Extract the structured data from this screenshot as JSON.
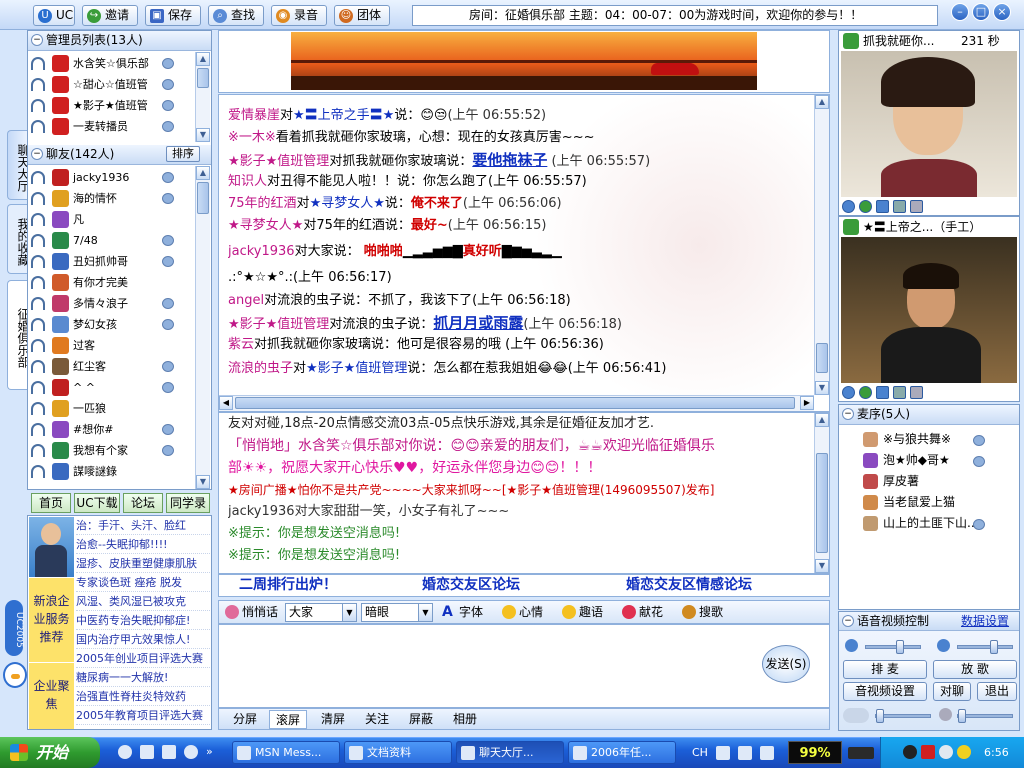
{
  "toolbar": {
    "uc": "UC",
    "invite": "邀请",
    "save": "保存",
    "find": "查找",
    "record": "录音",
    "group": "团体"
  },
  "roominfo": "房间：征婚俱乐部    主题：04：00-07：00为游戏时间，欢迎你的参与！！",
  "sidetabs": [
    "聊天大厅",
    "我的收藏",
    "征婚俱乐部"
  ],
  "admins": {
    "header": "管理员列表(13人)",
    "items": [
      "水含笑☆俱乐部",
      "☆甜心☆值班管",
      "★影子★值班管",
      "一麦转播员"
    ]
  },
  "friends": {
    "header": "聊友(142人)",
    "sort": "排序",
    "items": [
      "jacky1936",
      "海的情怀",
      "凡",
      "7/48",
      "丑妇抓帅哥",
      "有你才完美",
      "多情々浪子",
      "梦幻女孩",
      "过客",
      "红尘客",
      "^ ^",
      "一匹狼",
      "#想你#",
      "我想有个家",
      "謀嘜謎錄"
    ]
  },
  "nav": [
    "首页",
    "UC下载",
    "论坛",
    "同学录"
  ],
  "ads": {
    "side1": "新浪企业服务推荐",
    "side2": "企业聚焦",
    "lines": [
      "治：手汗、头汗、脸红",
      "治愈--失眠抑郁!!!!",
      "湿疹、皮肤重塑健康肌肤",
      "专家谈色斑 痤疮 脱发",
      "风湿、类风湿已被攻克",
      "中医药专治失眠抑郁症!",
      "国内治疗甲亢效果惊人!",
      "2005年创业项目评选大赛",
      "糖尿病一一大解放!",
      "治强直性脊柱炎特效药",
      "2005年教育项目评选大赛"
    ]
  },
  "uc_logo": "UC2005",
  "chat1": [
    {
      "segs": [
        {
          "t": "爱情暴崖",
          "c": "u"
        },
        {
          "t": "对"
        },
        {
          "t": "★〓上帝之手〓★",
          "c": "bl"
        },
        {
          "t": "说："
        },
        {
          "t": "😊😒",
          "c": "em"
        },
        {
          "t": "(上午 06:55:52)",
          "c": "ts"
        }
      ]
    },
    {
      "segs": [
        {
          "t": "※一木※",
          "c": "u"
        },
        {
          "t": "看着抓我就砸你家玻璃，心想：现在的女孩真厉害~~~"
        }
      ]
    },
    {
      "segs": [
        {
          "t": "★影子★值班管理",
          "c": "u"
        },
        {
          "t": "对抓我就砸你家玻璃说："
        },
        {
          "t": "要他拖袜子",
          "c": "lk"
        },
        {
          "t": " (上午 06:55:57)",
          "c": "ts"
        }
      ]
    },
    {
      "segs": [
        {
          "t": "知识人",
          "c": "u"
        },
        {
          "t": "对丑得不能见人啦！！说：你怎么跑了(上午 06:55:57)"
        }
      ]
    },
    {
      "segs": [
        {
          "t": "75年的红酒",
          "c": "u"
        },
        {
          "t": "对"
        },
        {
          "t": "★寻梦女人★",
          "c": "bl"
        },
        {
          "t": "说："
        },
        {
          "t": "俺不来了",
          "c": "rd"
        },
        {
          "t": "(上午 06:56:06)",
          "c": "ts"
        }
      ]
    },
    {
      "segs": [
        {
          "t": "★寻梦女人★",
          "c": "u"
        },
        {
          "t": "对75年的红酒说："
        },
        {
          "t": "最好~",
          "c": "rd"
        },
        {
          "t": "(上午 06:56:15)",
          "c": "ts"
        }
      ]
    },
    {
      "segs": [
        {
          "t": "jacky1936",
          "c": "u"
        },
        {
          "t": "对大家说：  "
        },
        {
          "t": "啪啪啪",
          "c": "rd"
        },
        {
          "t": "▁▂▃▅▆▇"
        },
        {
          "t": "真好听",
          "c": "rd"
        },
        {
          "t": "▇▆▅▃▂▁"
        }
      ]
    },
    {
      "segs": [
        {
          "t": ".:°★☆★°.:(上午 06:56:17)"
        }
      ]
    },
    {
      "segs": [
        {
          "t": "angel",
          "c": "u"
        },
        {
          "t": "对流浪的虫子说：不抓了，我该下了(上午 06:56:18)"
        }
      ]
    },
    {
      "segs": [
        {
          "t": "★影子★值班管理",
          "c": "u"
        },
        {
          "t": "对流浪的虫子说："
        },
        {
          "t": "抓月月或雨露",
          "c": "lk"
        },
        {
          "t": "(上午 06:56:18)",
          "c": "ts"
        }
      ]
    },
    {
      "segs": [
        {
          "t": "紫云",
          "c": "u"
        },
        {
          "t": "对抓我就砸你家玻璃说：他可是很容易的哦 (上午 06:56:36)"
        }
      ]
    },
    {
      "segs": [
        {
          "t": "流浪的虫子",
          "c": "u"
        },
        {
          "t": "对"
        },
        {
          "t": "★影子★值班管理",
          "c": "bl"
        },
        {
          "t": "说：怎么都在惹我姐姐😂😂(上午 06:56:41)"
        }
      ]
    }
  ],
  "chat2": [
    "友对对碰,18点-20点情感交流03点-05点快乐游戏,其余是征婚征友加才艺.",
    "「悄悄地」水含笑☆俱乐部对你说：😊😊亲爱的朋友们，☕☕欢迎光临征婚俱乐",
    "部☀☀，祝愿大家开心快乐♥♥，好运永伴您身边😊😊！！！",
    "★房间广播★怕你不是共产党~~~~大家来抓呀~~[★影子★值班管理(1496095507)发布]",
    "jacky1936对大家甜甜一笑，小女子有礼了~~~",
    "※提示：你是想发送空消息吗!",
    "※提示：你是想发送空消息吗!"
  ],
  "links": [
    "二周排行出炉！",
    "婚恋交友区论坛",
    "婚恋交友区情感论坛"
  ],
  "input": {
    "whisper": "悄悄话",
    "target": "大家",
    "action": "暗眼",
    "font": "字体",
    "mood": "心情",
    "fun": "趣语",
    "flower": "献花",
    "dance": "搜歌",
    "send": "发送(S)"
  },
  "bottomtabs": [
    "分屏",
    "滚屏",
    "清屏",
    "关注",
    "屏蔽",
    "相册"
  ],
  "video1": {
    "name": "抓我就砸你...",
    "timer": "231 秒"
  },
  "video2": {
    "name": "★〓上帝之...（手工）"
  },
  "mic": {
    "header": "麦序(5人)",
    "items": [
      "※与狼共舞※",
      "泡★帅◆哥★",
      "厚皮薯",
      "当老鼠爱上猫",
      "山上的土匪下山..."
    ]
  },
  "avctl": {
    "header": "语音视频控制",
    "settings": "数据设置",
    "speak": "排 麦",
    "sing": "放 歌",
    "avsettings": "音视频设置",
    "pm": "对聊",
    "quit": "退出"
  },
  "taskbar": {
    "start": "开始",
    "tasks": [
      "MSN Mess...",
      "文档资料",
      "聊天大厅...",
      "2006年任..."
    ],
    "battery": "99%",
    "lang": "CH",
    "clock": "6:56"
  },
  "colors": {
    "bg": "#d6e6fb",
    "accent": "#1030c0",
    "magenta": "#c01888"
  }
}
